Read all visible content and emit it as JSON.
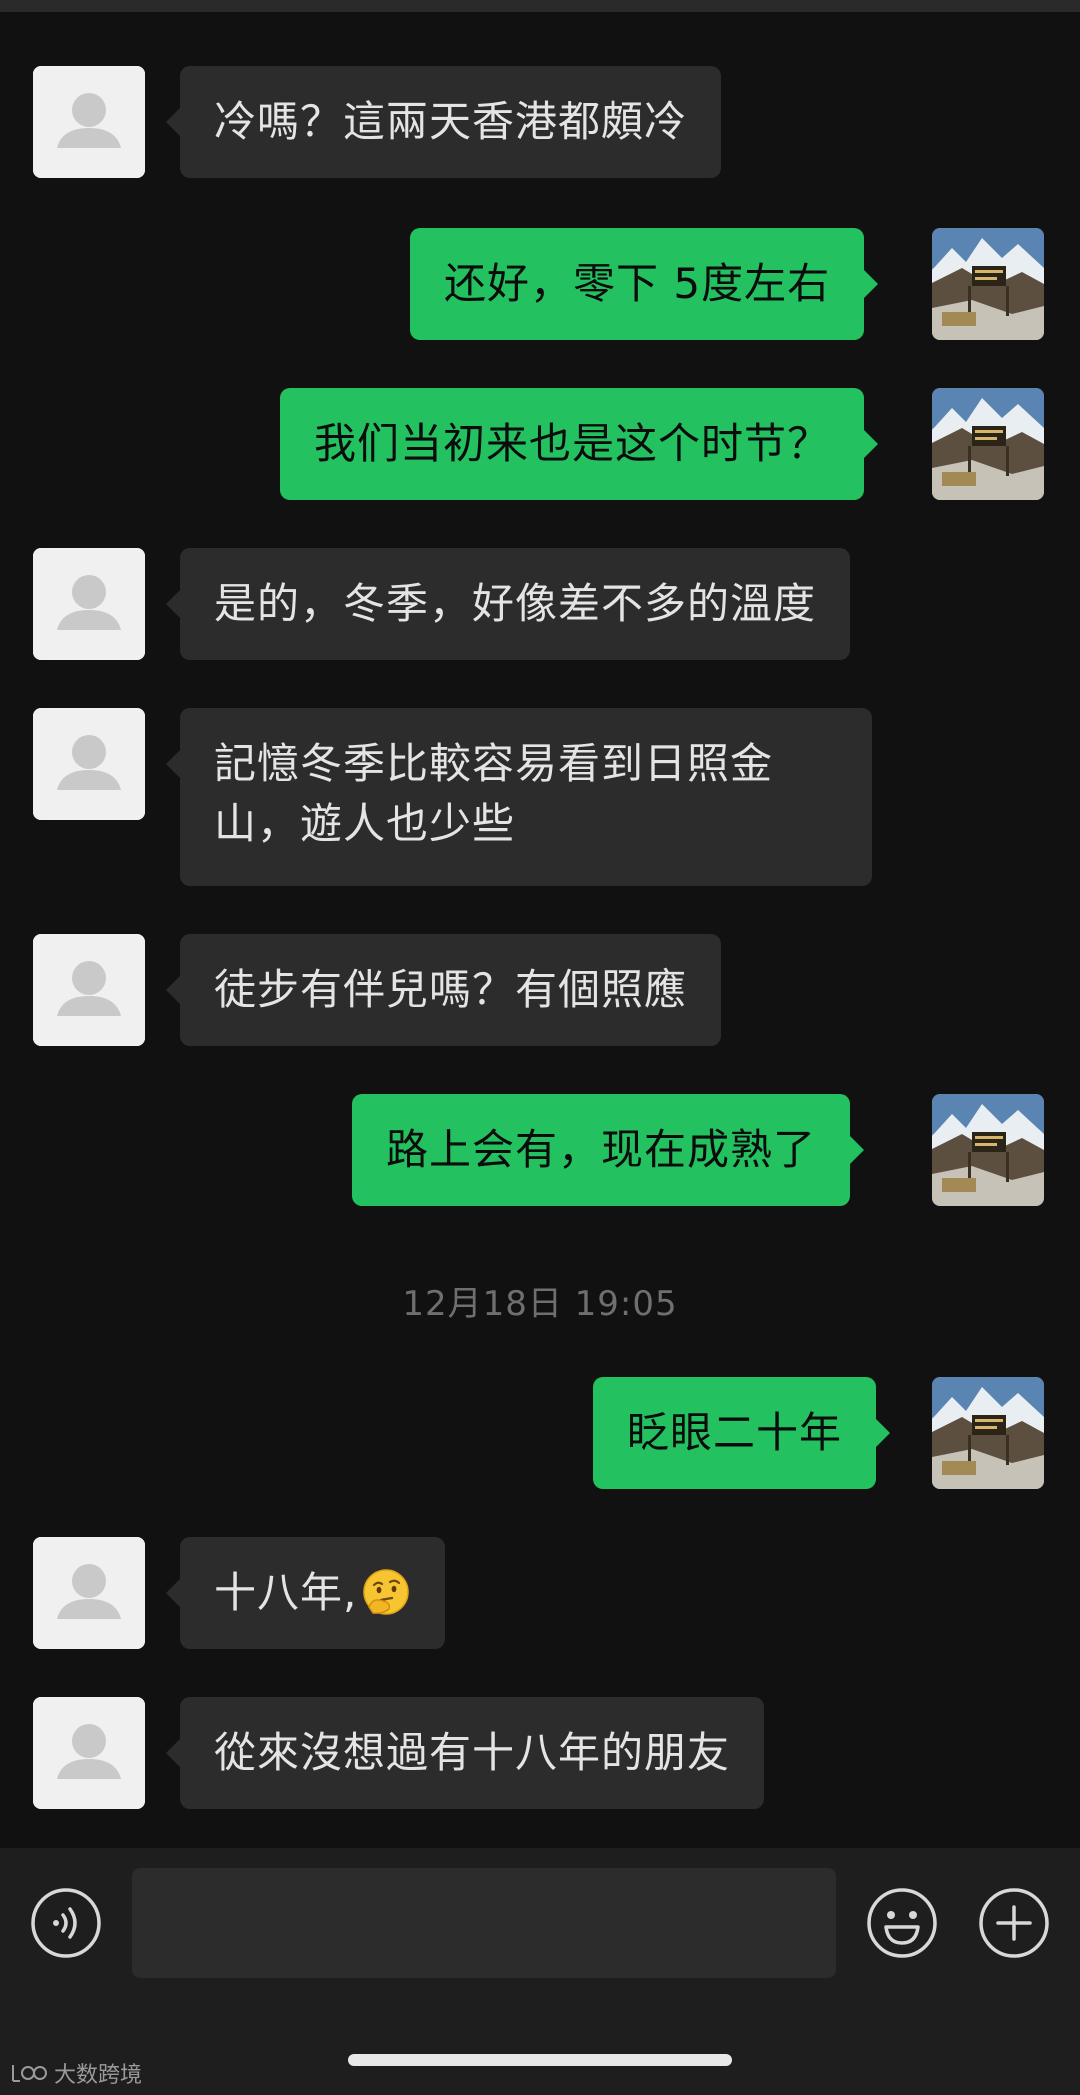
{
  "chat": {
    "messages": [
      {
        "side": "left",
        "text": "冷嗎？這兩天香港都頗冷"
      },
      {
        "side": "right",
        "text": "还好，零下 5度左右"
      },
      {
        "side": "right",
        "text": "我们当初来也是这个时节？"
      },
      {
        "side": "left",
        "text": "是的，冬季，好像差不多的溫度"
      },
      {
        "side": "left",
        "text": "記憶冬季比較容易看到日照金\n山，遊人也少些"
      },
      {
        "side": "left",
        "text": "徒步有伴兒嗎？有個照應"
      },
      {
        "side": "right",
        "text": "路上会有，现在成熟了"
      },
      {
        "side": "right",
        "text": "眨眼二十年"
      },
      {
        "side": "left",
        "text": "十八年,",
        "emoji": "thinking-face-emoji"
      },
      {
        "side": "left",
        "text": "從來沒想過有十八年的朋友"
      }
    ],
    "timestamp": "12月18日 19:05"
  },
  "input_bar": {
    "voice_icon": "voice-icon",
    "emoji_icon": "smiley-icon",
    "plus_icon": "plus-icon",
    "input_value": ""
  },
  "watermark": {
    "text": "大数跨境"
  },
  "colors": {
    "background": "#111111",
    "incoming_bubble": "#2c2c2c",
    "outgoing_bubble": "#23c160",
    "timestamp_text": "#6f6f6f"
  }
}
